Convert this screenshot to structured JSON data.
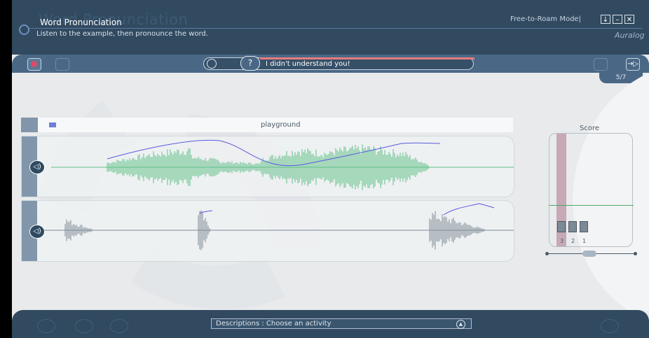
{
  "header": {
    "title": "Word Pronunciation",
    "ghost_title": "Word Pronunciation",
    "subtitle": "Listen to the example, then pronounce the word.",
    "mode": "Free-to-Roam Mode|",
    "window_buttons": [
      "↓",
      "–",
      "✕"
    ],
    "brand": "Auralog"
  },
  "toolbar": {
    "feedback_message": "I didn't understand you!",
    "counter": "5/7",
    "next_icon": "→▷"
  },
  "word": {
    "label": "playground"
  },
  "score": {
    "label": "Score",
    "levels": [
      "3",
      "2",
      "1"
    ]
  },
  "footer": {
    "description": "Descriptions : Choose an activity",
    "up_icon": "▲"
  },
  "colors": {
    "header_bg": "#314a60",
    "toolbar_bg": "#4a6886",
    "model_wave": "#5fbf86",
    "user_wave": "#7d8a97",
    "pitch_line": "#5a5ae0",
    "error_bar": "#e87b7d"
  }
}
